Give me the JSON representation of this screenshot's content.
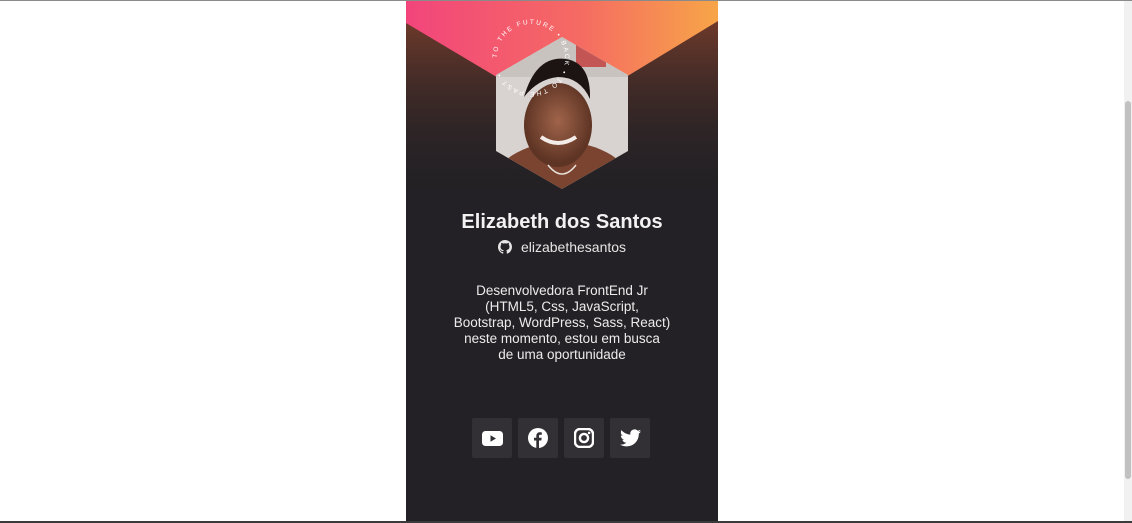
{
  "profile": {
    "name": "Elizabeth dos Santos",
    "github_user": "elizabethesantos",
    "bio_lines": [
      "Desenvolvedora FrontEnd Jr",
      "(HTML5, Css, JavaScript,",
      "Bootstrap, WordPress, Sass, React)",
      "neste momento, estou em busca",
      "de uma oportunidade"
    ],
    "ring_text": "TO THE FUTURE • BACK • TO THE PAST •"
  },
  "social": [
    {
      "icon": "youtube-icon"
    },
    {
      "icon": "facebook-icon"
    },
    {
      "icon": "instagram-icon"
    },
    {
      "icon": "twitter-icon"
    }
  ],
  "colors": {
    "card_bg": "#232125",
    "gradient_start": "#f2467b",
    "gradient_end": "#f7a548",
    "button_bg": "#323035",
    "text": "#f2f2f2"
  }
}
